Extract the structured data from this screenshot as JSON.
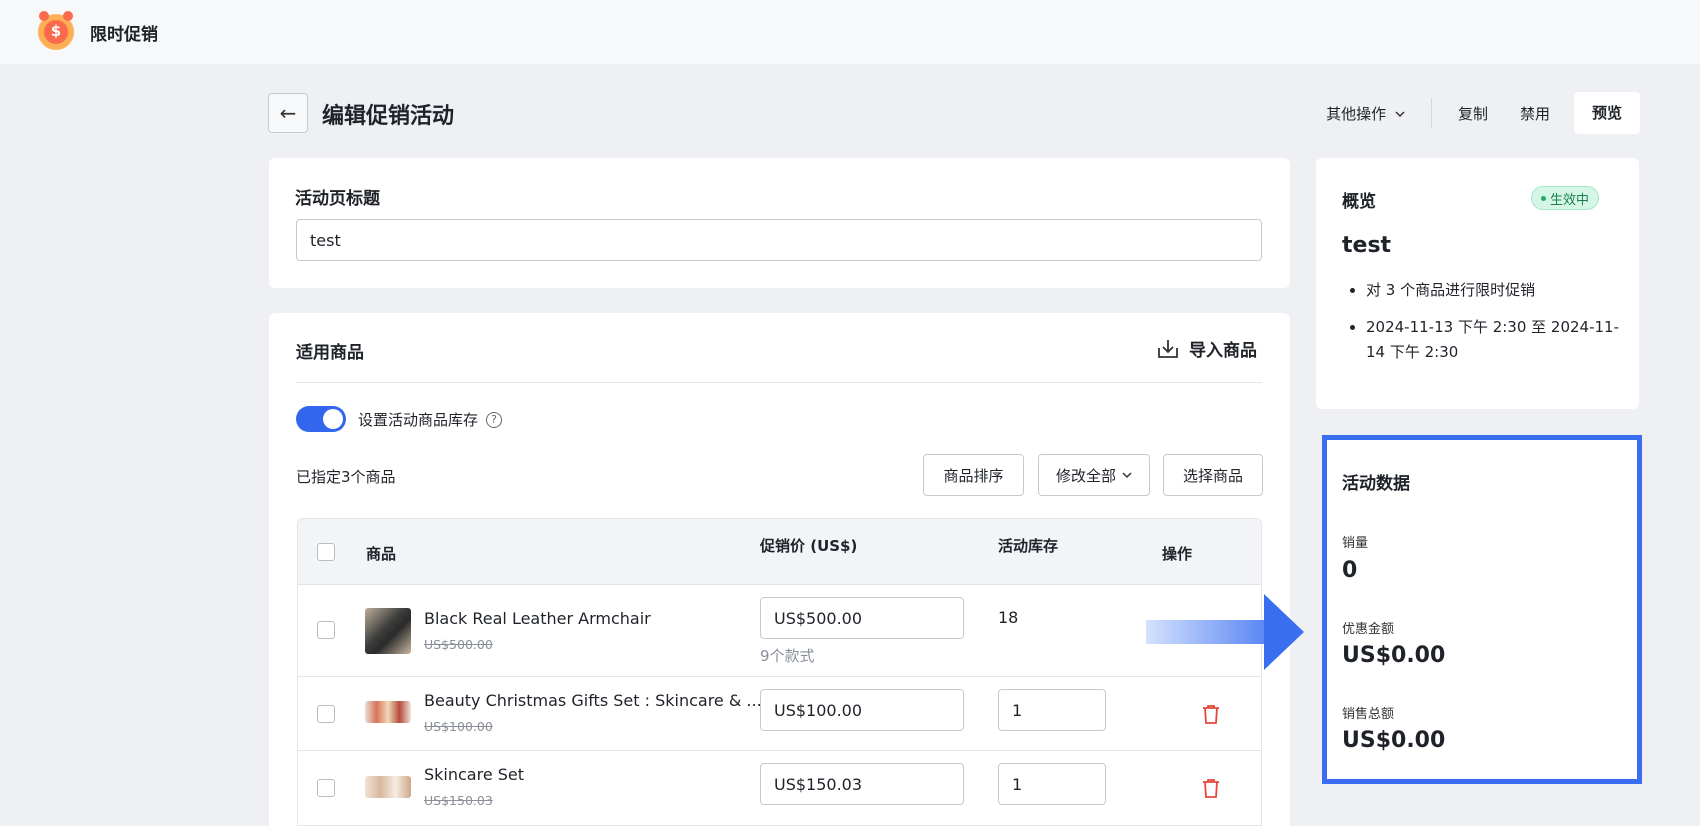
{
  "app": {
    "title": "限时促销",
    "logo_symbol": "$"
  },
  "header": {
    "back_icon": "←",
    "page_title": "编辑促销活动",
    "actions": {
      "more": "其他操作",
      "copy": "复制",
      "disable": "禁用",
      "preview": "预览"
    }
  },
  "title_card": {
    "label": "活动页标题",
    "value": "test"
  },
  "products": {
    "section_title": "适用商品",
    "import_label": "导入商品",
    "toggle_label": "设置活动商品库存",
    "toggle_on": true,
    "assigned_text": "已指定3个商品",
    "buttons": {
      "sort": "商品排序",
      "edit_all": "修改全部",
      "select": "选择商品"
    },
    "columns": {
      "product": "商品",
      "price": "促销价 (US$)",
      "stock": "活动库存",
      "actions": "操作"
    },
    "rows": [
      {
        "name": "Black Real Leather Armchair",
        "original_price": "US$500.00",
        "promo_price": "US$500.00",
        "variants": "9个款式",
        "stock": "18"
      },
      {
        "name": "Beauty Christmas Gifts Set : Skincare & ...",
        "original_price": "US$100.00",
        "promo_price": "US$100.00",
        "stock": "1"
      },
      {
        "name": "Skincare Set",
        "original_price": "US$150.03",
        "promo_price": "US$150.03",
        "stock": "1"
      }
    ]
  },
  "overview": {
    "title": "概览",
    "status": "生效中",
    "name": "test",
    "bullets": [
      "对 3 个商品进行限时促销",
      "2024-11-13 下午 2:30 至 2024-11-14 下午 2:30"
    ]
  },
  "stats": {
    "title": "活动数据",
    "sales_label": "销量",
    "sales_value": "0",
    "discount_label": "优惠金额",
    "discount_value": "US$0.00",
    "total_label": "销售总额",
    "total_value": "US$0.00"
  },
  "colors": {
    "accent": "#3366ee",
    "highlight_border": "#3a6ef0",
    "danger": "#e5483a",
    "status_green": "#1fa868"
  }
}
